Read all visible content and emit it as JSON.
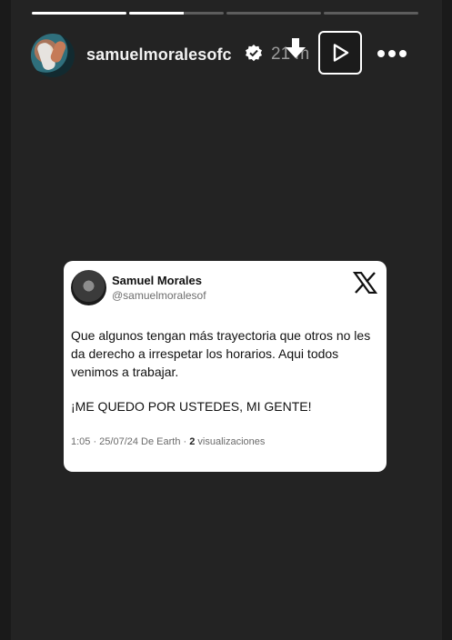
{
  "story": {
    "progress": [
      1,
      0.58,
      0,
      0
    ]
  },
  "header": {
    "username": "samuelmoralesofc",
    "time": "21 m",
    "icons": [
      "verified-badge-icon",
      "download-icon",
      "play-icon",
      "more-icon"
    ]
  },
  "tweet": {
    "name": "Samuel Morales",
    "handle": "@samuelmoralesof",
    "body": "Que algunos tengan más trayectoria que otros no les da derecho a irrespetar los horarios. Aqui todos venimos a trabajar.",
    "shout": "¡ME QUEDO POR USTEDES, MI GENTE!",
    "meta_prefix": "1:05 · 25/07/24 De Earth · ",
    "views_count": "2",
    "views_label": " visualizaciones"
  },
  "colors": {
    "background": "#232323",
    "card": "#ffffff",
    "progress_active": "#ffffff",
    "progress_inactive": "#5d5d5d"
  }
}
